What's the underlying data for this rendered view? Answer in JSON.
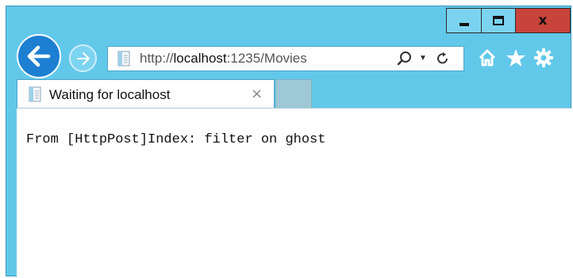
{
  "window": {
    "controls": {
      "minimize_icon": "minimize-icon",
      "maximize_icon": "maximize-icon",
      "close_glyph": "x"
    }
  },
  "nav": {
    "back_icon": "back-arrow-icon",
    "forward_icon": "forward-arrow-icon"
  },
  "address": {
    "scheme": "http://",
    "host": "localhost",
    "rest": ":1235/Movies"
  },
  "toolbar": {
    "icons": [
      "home-icon",
      "favorites-star-icon",
      "settings-gear-icon"
    ]
  },
  "tabs": [
    {
      "title": "Waiting for localhost",
      "close_glyph": "×"
    }
  ],
  "page": {
    "body_text": "From [HttpPost]Index: filter on ghost"
  },
  "colors": {
    "chrome": "#62c8ea",
    "back_button": "#1d7fd2",
    "close_button": "#c7433b"
  }
}
